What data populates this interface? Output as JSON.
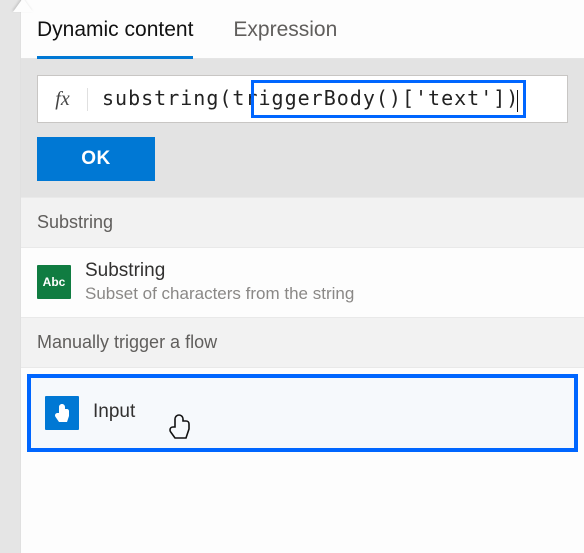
{
  "tabs": {
    "dynamic": "Dynamic content",
    "expression": "Expression"
  },
  "expression": {
    "fx_label": "fx",
    "value": "substring(triggerBody()['text'])",
    "ok": "OK"
  },
  "groups": {
    "substring": {
      "header": "Substring",
      "item_title": "Substring",
      "item_desc": "Subset of characters from the string",
      "icon": "Abc"
    },
    "trigger": {
      "header": "Manually trigger a flow",
      "input_label": "Input"
    }
  }
}
